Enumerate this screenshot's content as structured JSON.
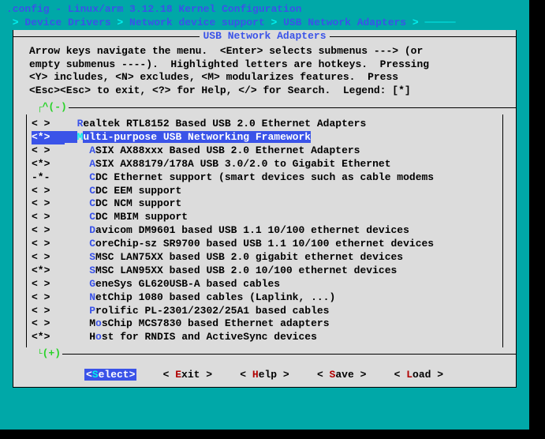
{
  "title": ".config - Linux/arm 3.12.18 Kernel Configuration",
  "breadcrumb": {
    "prefix": " > ",
    "parts": [
      "Device Drivers",
      "Network device support",
      "USB Network Adapters"
    ],
    "sep": " > "
  },
  "window_title": "USB Network Adapters",
  "help_text": "Arrow keys navigate the menu.  <Enter> selects submenus ---> (or\nempty submenus ----).  Highlighted letters are hotkeys.  Pressing\n<Y> includes, <N> excludes, <M> modularizes features.  Press\n<Esc><Esc> to exit, <?> for Help, </> for Search.  Legend: [*]",
  "scroll_top": "^(-)",
  "scroll_bottom": "(+)",
  "items": [
    {
      "marker": "< >",
      "hotkey": "R",
      "rest": "ealtek RTL8152 Based USB 2.0 Ethernet Adapters",
      "indent": "  "
    },
    {
      "marker": "<*>",
      "hotkey": "M",
      "rest": "ulti-purpose USB Networking Framework",
      "indent": "  ",
      "selected": true
    },
    {
      "marker": "< >",
      "hotkey": "A",
      "rest": "SIX AX88xxx Based USB 2.0 Ethernet Adapters",
      "indent": "    "
    },
    {
      "marker": "<*>",
      "hotkey": "A",
      "rest": "SIX AX88179/178A USB 3.0/2.0 to Gigabit Ethernet",
      "indent": "    "
    },
    {
      "marker": "-*-",
      "hotkey": "C",
      "rest": "DC Ethernet support (smart devices such as cable modems",
      "indent": "    "
    },
    {
      "marker": "< >",
      "hotkey": "C",
      "rest": "DC EEM support",
      "indent": "    "
    },
    {
      "marker": "< >",
      "hotkey": "C",
      "rest": "DC NCM support",
      "indent": "    "
    },
    {
      "marker": "< >",
      "hotkey": "C",
      "rest": "DC MBIM support",
      "indent": "    "
    },
    {
      "marker": "< >",
      "hotkey": "D",
      "rest": "avicom DM9601 based USB 1.1 10/100 ethernet devices",
      "indent": "    "
    },
    {
      "marker": "< >",
      "hotkey": "C",
      "rest": "oreChip-sz SR9700 based USB 1.1 10/100 ethernet devices",
      "indent": "    "
    },
    {
      "marker": "< >",
      "hotkey": "S",
      "rest": "MSC LAN75XX based USB 2.0 gigabit ethernet devices",
      "indent": "    "
    },
    {
      "marker": "<*>",
      "hotkey": "S",
      "rest": "MSC LAN95XX based USB 2.0 10/100 ethernet devices",
      "indent": "    "
    },
    {
      "marker": "< >",
      "hotkey": "G",
      "rest": "eneSys GL620USB-A based cables",
      "indent": "    "
    },
    {
      "marker": "< >",
      "hotkey": "N",
      "rest": "etChip 1080 based cables (Laplink, ...)",
      "indent": "    "
    },
    {
      "marker": "< >",
      "hotkey": "P",
      "rest": "rolific PL-2301/2302/25A1 based cables",
      "indent": "    "
    },
    {
      "marker": "< >",
      "hotkey": "M",
      "rest": "",
      "rest_pre": "",
      "mid_hotkey": "o",
      "post": "sChip MCS7830 based Ethernet adapters",
      "indent": "    ",
      "split": true
    },
    {
      "marker": "<*>",
      "hotkey": "H",
      "rest": "",
      "rest_pre": "",
      "mid_hotkey": "o",
      "post": "st for RNDIS and ActiveSync devices",
      "indent": "    ",
      "split": true
    }
  ],
  "buttons": [
    {
      "pre": "<",
      "hotkey": "S",
      "post": "elect>",
      "selected": true
    },
    {
      "pre": "< ",
      "hotkey": "E",
      "post": "xit >"
    },
    {
      "pre": "< ",
      "hotkey": "H",
      "post": "elp >"
    },
    {
      "pre": "< ",
      "hotkey": "S",
      "post": "ave >"
    },
    {
      "pre": "< ",
      "hotkey": "L",
      "post": "oad >"
    }
  ]
}
